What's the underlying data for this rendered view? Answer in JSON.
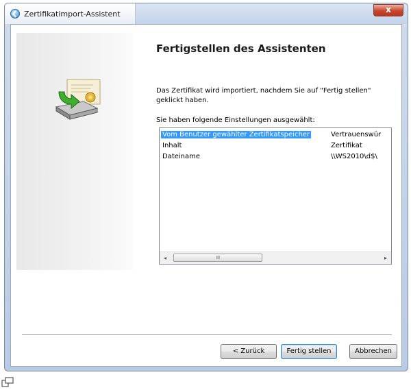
{
  "window": {
    "title": "Zertifikatimport-Assistent",
    "close_label": "x"
  },
  "page": {
    "heading": "Fertigstellen des Assistenten",
    "intro": "Das Zertifikat wird importiert, nachdem Sie auf \"Fertig stellen\" geklickt haben.",
    "settings_label": "Sie haben folgende Einstellungen ausgewählt:"
  },
  "settings": {
    "rows": [
      {
        "key": "Vom Benutzer gewählter Zertifikatspeicher",
        "value": "Vertrauenswür",
        "selected": true
      },
      {
        "key": "Inhalt",
        "value": "Zertifikat"
      },
      {
        "key": "Dateiname",
        "value": "\\\\WS2010\\d$\\"
      }
    ],
    "scroll_left": "◂",
    "scroll_right": "▸",
    "thumb_grip": "III"
  },
  "buttons": {
    "back": "< Zurück",
    "finish": "Fertig stellen",
    "cancel": "Abbrechen"
  },
  "icons": {
    "back": "back-arrow-icon",
    "wizard": "certificate-import-icon",
    "resize": "expand-icon"
  }
}
